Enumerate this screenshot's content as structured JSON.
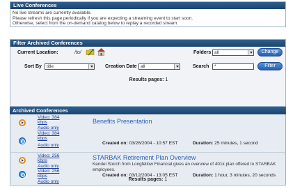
{
  "live": {
    "title": "Live Conferences",
    "line1": "No live streams are currently available.",
    "line2": "Please refresh this page periodically if you are expecting a streaming event to start soon.",
    "line3": "Otherwise, select from the on-demand catalog below to replay a recorded stream."
  },
  "filter": {
    "title": "Filter Archived Conferences",
    "current_location_label": "Current Location:",
    "current_location_value": "/to/",
    "folders_label": "Folders",
    "folders_value": "all",
    "change_button": "Change",
    "sort_by_label": "Sort By",
    "sort_by_value": "title",
    "creation_date_label": "Creation Date",
    "creation_date_value": "all",
    "search_label": "Search",
    "search_value": "*",
    "filter_button": "Filter",
    "results_pages_label": "Results pages:",
    "results_pages_value": "1"
  },
  "archived": {
    "title": "Archived Conferences",
    "items": [
      {
        "video1": "Video: 384 kbps",
        "audio1": "Audio only",
        "video2": "Video: 384 kbps",
        "audio2": "Audio only",
        "title": "Benefits Presentation",
        "description": "",
        "created_label": "Created on:",
        "created_value": "03/26/2004 - 10:57 EST",
        "duration_label": "Duration:",
        "duration_value": "25 minutes, 1 second"
      },
      {
        "video1": "Video: 256 kbps",
        "audio1": "Audio only",
        "video2": "Video: 256 kbps",
        "audio2": "Audio only",
        "title": "STARBAK Retirement Plan Overview",
        "description": "Kendel Storch from Longfellow Financial gives an overview of 401k plan offered to STARBAK employees.",
        "created_label": "Created on:",
        "created_value": "03/12/2004 - 13:05 EST",
        "duration_label": "Duration:",
        "duration_value": "1 hour, 3 minutes, 20 seconds"
      }
    ],
    "results_pages_label": "Results pages:",
    "results_pages_value": "1"
  },
  "icons": {
    "folder": "folder-up-icon",
    "home": "home-icon",
    "player1": "realplayer-icon",
    "player2": "quicktime-icon"
  }
}
